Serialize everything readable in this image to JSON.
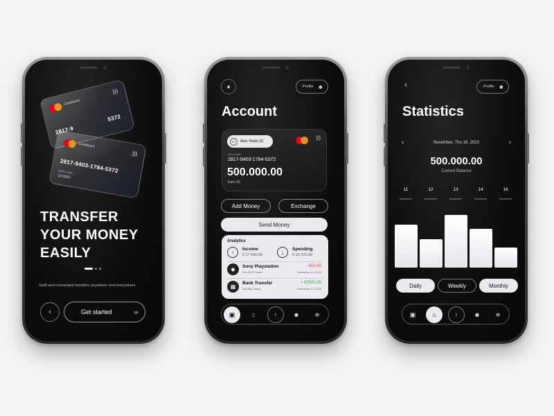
{
  "onboarding": {
    "card_front": {
      "brand": "Creditcard",
      "number": "2817-9403-1784-5372",
      "expiry_label": "Expiry Date",
      "expiry": "12-2022"
    },
    "card_back": {
      "brand": "Creditcard",
      "number_partial": "2817-9",
      "number_end": "5372"
    },
    "headline": [
      "TRANSFER",
      "YOUR MONEY",
      "EASILY"
    ],
    "tagline": "Swift and convenient transfers anywhere and everywhere",
    "back_glyph": "‹",
    "cta_label": "Get started",
    "cta_glyph": "›››"
  },
  "account": {
    "profile_label": "Profile",
    "title": "Account",
    "wallet": {
      "tag": "Main Wallet (€)",
      "sub_label": "Terra Date",
      "number": "2817-9403-1784-5372",
      "balance": "500.000.00",
      "currency": "Euro (€)"
    },
    "buttons": {
      "add": "Add Money",
      "exchange": "Exchange",
      "send": "Send Money"
    },
    "analytics": {
      "title": "Analytics",
      "income_label": "Income",
      "income_value": "€ 17.540.99",
      "spending_label": "Spending",
      "spending_value": "€ 10.370.99",
      "transactions": [
        {
          "title": "Sony Playstation",
          "sub": "Fifa 2022 Game",
          "amount": "- €53.95",
          "date": "November 14, 2023",
          "color": "#d64545"
        },
        {
          "title": "Bank Transfer",
          "sub": "Monthly Salary",
          "amount": "+ €2500.95",
          "date": "November 14, 2023",
          "color": "#2fae5b"
        }
      ]
    }
  },
  "statistics": {
    "profile_label": "Profile",
    "title": "Statistics",
    "date": "November, Thu 16, 2023",
    "balance": "500.000.00",
    "balance_label": "Current Balance",
    "days": [
      {
        "num": "11",
        "month": "November"
      },
      {
        "num": "12",
        "month": "November"
      },
      {
        "num": "13",
        "month": "November"
      },
      {
        "num": "14",
        "month": "November"
      },
      {
        "num": "16",
        "month": "November"
      }
    ],
    "chart_data": {
      "type": "bar",
      "categories": [
        "11",
        "12",
        "13",
        "14",
        "16"
      ],
      "values": [
        0.74,
        0.49,
        0.9,
        0.67,
        0.34
      ],
      "ylim": [
        0,
        1
      ]
    },
    "tabs": {
      "daily": "Daily",
      "weekly": "Weekly",
      "monthly": "Monthly"
    }
  },
  "icons": {
    "bell": "bell-icon",
    "user": "user-icon",
    "wallet": "wallet-icon",
    "home": "home-icon",
    "arrow-up": "arrow-up-icon",
    "arrow-down": "arrow-down-icon",
    "settings": "sliders-icon",
    "playstation": "playstation-icon",
    "bank": "bank-icon",
    "contactless": "contactless-icon"
  },
  "colors": {
    "screen": "#0d0d0d",
    "light_surface": "#e9e9ee",
    "negative": "#d64545",
    "positive": "#2fae5b",
    "mastercard_red": "#eb001b",
    "mastercard_orange": "#f79e1b"
  }
}
